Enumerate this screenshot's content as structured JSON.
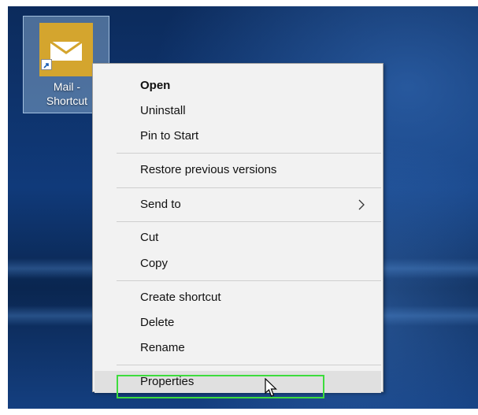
{
  "desktop_icon": {
    "label_line1": "Mail -",
    "label_line2": "Shortcut",
    "icon": "mail-app-icon"
  },
  "context_menu": {
    "items": [
      {
        "label": "Open",
        "bold": true
      },
      {
        "label": "Uninstall"
      },
      {
        "label": "Pin to Start"
      },
      {
        "label": "Restore previous versions"
      },
      {
        "label": "Send to",
        "submenu": true
      },
      {
        "label": "Cut"
      },
      {
        "label": "Copy"
      },
      {
        "label": "Create shortcut"
      },
      {
        "label": "Delete"
      },
      {
        "label": "Rename"
      },
      {
        "label": "Properties",
        "hovered": true,
        "highlighted": true
      }
    ]
  },
  "colors": {
    "highlight_border": "#3ddc3d",
    "app_tile": "#d4a52e",
    "menu_background": "#f2f2f2",
    "hover_background": "#e0e0e0"
  }
}
